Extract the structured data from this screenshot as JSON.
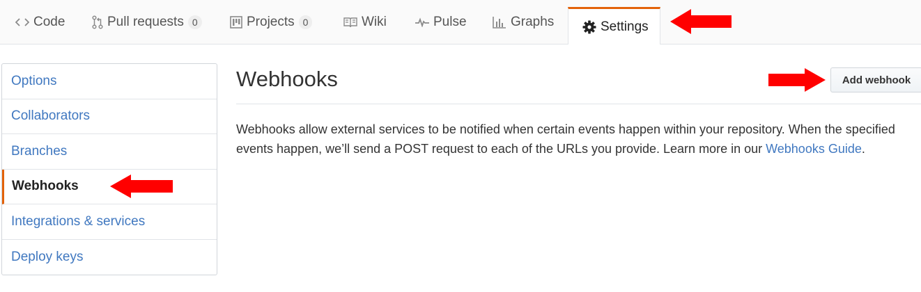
{
  "nav": {
    "tabs": [
      {
        "label": "Code",
        "icon": "code-icon"
      },
      {
        "label": "Pull requests",
        "icon": "git-pull-request-icon",
        "count": "0"
      },
      {
        "label": "Projects",
        "icon": "project-icon",
        "count": "0"
      },
      {
        "label": "Wiki",
        "icon": "book-icon"
      },
      {
        "label": "Pulse",
        "icon": "pulse-icon"
      },
      {
        "label": "Graphs",
        "icon": "graph-icon"
      },
      {
        "label": "Settings",
        "icon": "gear-icon",
        "selected": true
      }
    ]
  },
  "sidebar": {
    "items": [
      {
        "label": "Options"
      },
      {
        "label": "Collaborators"
      },
      {
        "label": "Branches"
      },
      {
        "label": "Webhooks",
        "selected": true
      },
      {
        "label": "Integrations & services"
      },
      {
        "label": "Deploy keys"
      }
    ]
  },
  "main": {
    "title": "Webhooks",
    "add_button": "Add webhook",
    "description": "Webhooks allow external services to be notified when certain events happen within your repository. When the specified events happen, we’ll send a POST request to each of the URLs you provide. Learn more in our ",
    "guide_link": "Webhooks Guide",
    "description_end": "."
  },
  "colors": {
    "accent": "#e36209",
    "link": "#4078c0",
    "annotation_arrow": "#ff0000"
  }
}
